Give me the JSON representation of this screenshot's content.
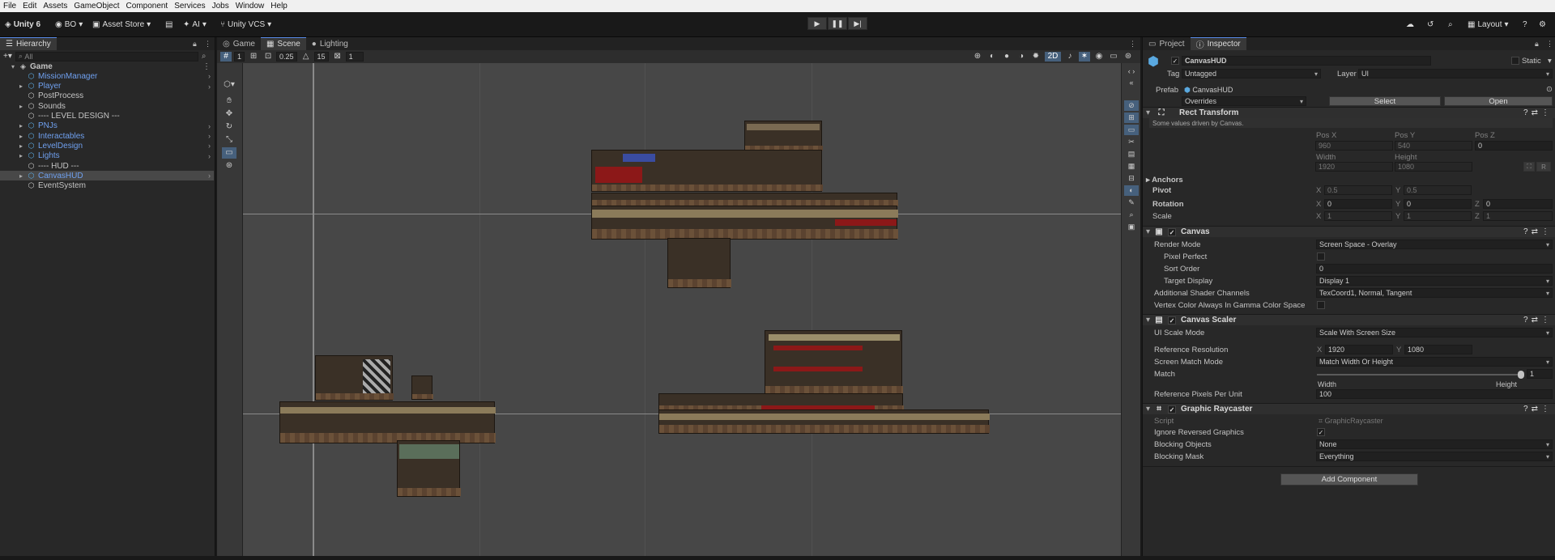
{
  "menubar": [
    "File",
    "Edit",
    "Assets",
    "GameObject",
    "Component",
    "Services",
    "Jobs",
    "Window",
    "Help"
  ],
  "toolbar": {
    "unity_label": "Unity 6",
    "account": "BO",
    "asset_store": "Asset Store",
    "ai": "AI",
    "vcs": "Unity VCS",
    "layout": "Layout"
  },
  "hierarchy": {
    "tab": "Hierarchy",
    "search_placeholder": "All",
    "items": [
      {
        "label": "Game",
        "level": 0,
        "blue": false
      },
      {
        "label": "MissionManager",
        "level": 1,
        "blue": true
      },
      {
        "label": "Player",
        "level": 1,
        "blue": true
      },
      {
        "label": "PostProcess",
        "level": 1,
        "blue": false
      },
      {
        "label": "Sounds",
        "level": 1,
        "blue": false
      },
      {
        "label": "---- LEVEL DESIGN ---",
        "level": 1,
        "blue": false
      },
      {
        "label": "PNJs",
        "level": 1,
        "blue": true
      },
      {
        "label": "Interactables",
        "level": 1,
        "blue": true
      },
      {
        "label": "LevelDesign",
        "level": 1,
        "blue": true
      },
      {
        "label": "Lights",
        "level": 1,
        "blue": true
      },
      {
        "label": "---- HUD ---",
        "level": 1,
        "blue": false
      },
      {
        "label": "CanvasHUD",
        "level": 1,
        "blue": true
      },
      {
        "label": "EventSystem",
        "level": 1,
        "blue": false
      }
    ]
  },
  "scene": {
    "tabs": [
      "Game",
      "Scene",
      "Lighting"
    ],
    "active_tab": "Scene",
    "grid_size": "1",
    "snap_value": "0.25",
    "rotation_snap": "15",
    "scale_snap": "1",
    "mode_2d": "2D"
  },
  "inspector": {
    "tabs": [
      "Project",
      "Inspector"
    ],
    "object_name": "CanvasHUD",
    "static_label": "Static",
    "tag_label": "Tag",
    "tag_value": "Untagged",
    "layer_label": "Layer",
    "layer_value": "UI",
    "prefab_label": "Prefab",
    "prefab_value": "CanvasHUD",
    "overrides": "Overrides",
    "select_btn": "Select",
    "open_btn": "Open",
    "rect_transform": {
      "title": "Rect Transform",
      "note": "Some values driven by Canvas.",
      "pos_x_label": "Pos X",
      "pos_x": "960",
      "pos_y_label": "Pos Y",
      "pos_y": "540",
      "pos_z_label": "Pos Z",
      "pos_z": "0",
      "width_label": "Width",
      "width": "1920",
      "height_label": "Height",
      "height": "1080",
      "r_btn": "R",
      "anchors": "Anchors",
      "pivot_label": "Pivot",
      "pivot_x": "0.5",
      "pivot_y": "0.5",
      "rotation_label": "Rotation",
      "rot_x": "0",
      "rot_y": "0",
      "rot_z": "0",
      "scale_label": "Scale",
      "scale_x": "1",
      "scale_y": "1",
      "scale_z": "1",
      "x": "X",
      "y": "Y",
      "z": "Z"
    },
    "canvas": {
      "title": "Canvas",
      "render_mode_label": "Render Mode",
      "render_mode": "Screen Space - Overlay",
      "pixel_perfect_label": "Pixel Perfect",
      "sort_order_label": "Sort Order",
      "sort_order": "0",
      "target_display_label": "Target Display",
      "target_display": "Display 1",
      "shader_channels_label": "Additional Shader Channels",
      "shader_channels": "TexCoord1, Normal, Tangent",
      "vertex_color_label": "Vertex Color Always In Gamma Color Space"
    },
    "canvas_scaler": {
      "title": "Canvas Scaler",
      "ui_scale_mode_label": "UI Scale Mode",
      "ui_scale_mode": "Scale With Screen Size",
      "ref_res_label": "Reference Resolution",
      "ref_x": "1920",
      "ref_y": "1080",
      "match_mode_label": "Screen Match Mode",
      "match_mode": "Match Width Or Height",
      "match_label": "Match",
      "match_value": "1",
      "match_level": 1.0,
      "width_label": "Width",
      "height_label": "Height",
      "ppu_label": "Reference Pixels Per Unit",
      "ppu": "100"
    },
    "graphic_raycaster": {
      "title": "Graphic Raycaster",
      "script_label": "Script",
      "script": "GraphicRaycaster",
      "ignore_reversed_label": "Ignore Reversed Graphics",
      "blocking_objects_label": "Blocking Objects",
      "blocking_objects": "None",
      "blocking_mask_label": "Blocking Mask",
      "blocking_mask": "Everything"
    },
    "add_component": "Add Component"
  }
}
